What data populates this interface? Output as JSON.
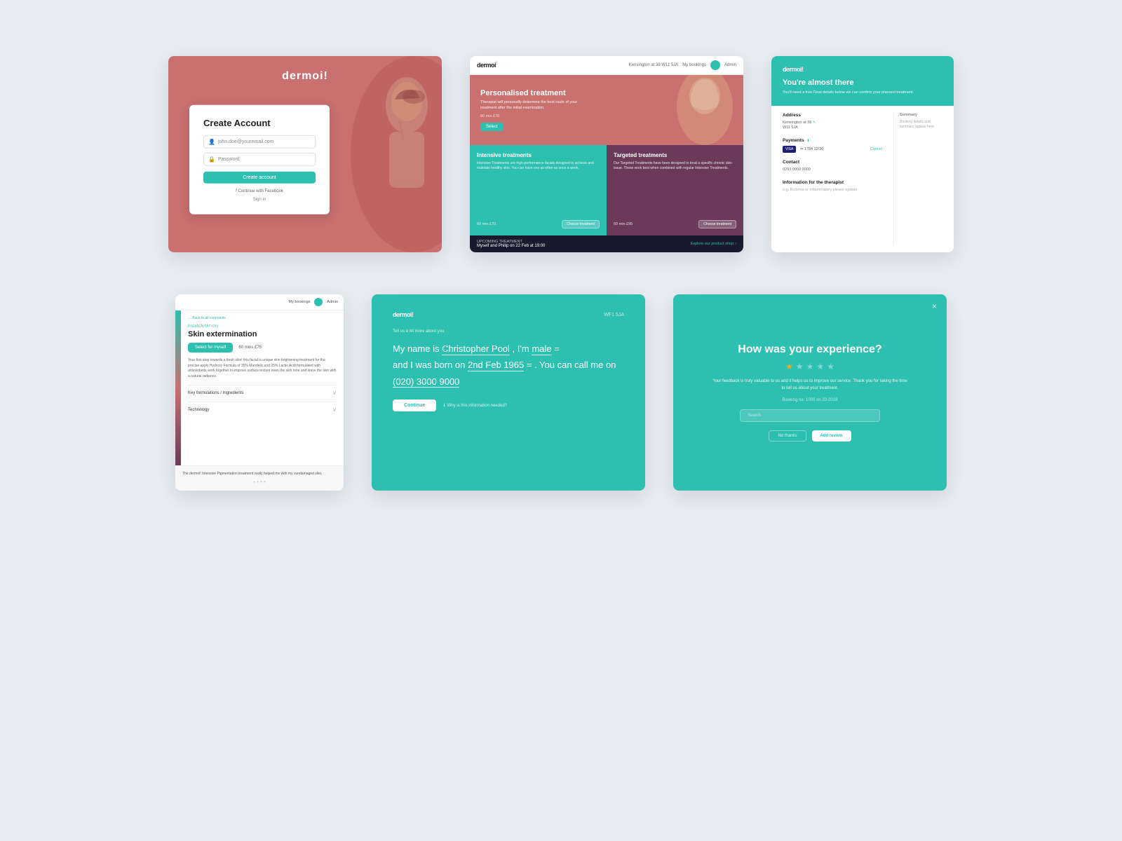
{
  "page": {
    "bg_color": "#e8edf2"
  },
  "card1": {
    "logo": "dermoi!",
    "title": "Create Account",
    "email_placeholder": "john.doe@youremail.com",
    "password_placeholder": "Password",
    "create_btn": "Create account",
    "fb_label": "Continue with Facebook",
    "signin_label": "Sign in"
  },
  "card2": {
    "logo": "dermoi!",
    "location": "Kensington at 38 W11 5JA",
    "my_bookings": "My bookings",
    "hero": {
      "title": "Personalised treatment",
      "description": "Therapist will personally determine the best route of your treatment after the initial examination.",
      "price": "60 min £70",
      "btn": "Select"
    },
    "intensive": {
      "title": "Intensive treatments",
      "description": "Intensive Treatments are high-performance facials designed to achieve and maintain healthy skin. You can have one as often as once a week.",
      "price": "60 min £70",
      "btn": "Choose treatment"
    },
    "targeted": {
      "title": "Targeted treatments",
      "description": "Our Targeted Treatments have been designed to treat a specific chronic skin issue. These work best when combined with regular Intensive Treatments.",
      "price": "60 min £95",
      "btn": "Choose treatment"
    },
    "footer": {
      "label": "UPCOMING TREATMENT",
      "booking": "Myself and Philip on 22 Feb at 19:00",
      "explore": "Explore our product shop"
    }
  },
  "card3": {
    "logo": "dermoi!",
    "header_title": "You're almost there",
    "header_desc": "You'll need a free Final details below we can confirm your planned treatment.",
    "address_label": "Address",
    "address_value": "Kensington at 38",
    "address_post": "W11 5JA",
    "payments_label": "Payments",
    "card_number": "•• 1784    12/30",
    "cancel": "Cancel",
    "contact_label": "Contact",
    "phone": "0203 0000 9000",
    "therapist_label": "Information for the therapist",
    "therapist_placeholder": "e.g. Eczema or inflammatory please update"
  },
  "card4": {
    "my_bookings": "My bookings",
    "back_link": "Back to all comments",
    "category": "PIGMENTATION",
    "title": "Skin extermination",
    "btn_select": "Select for myself",
    "price": "60 mins £75",
    "description": "Your first step towards a fresh skin! this facial is unique skin brightening treatment for the precise apply Hydroxy Formula of 35% Mandelic and 25% Lactic Acid formulated with antioxidants work together to improve surface texture even the skin tone and leave the skin with a natural radiance.",
    "ingredients_label": "Key formulations / Ingredients",
    "technology_label": "Technology",
    "testimonial": "The dermoi! Intensive Pigmentation treatment really helped me with my sundamaged skin."
  },
  "card5": {
    "logo": "dermoi!",
    "wifi": "WF1 5JA",
    "tell_us": "Tell us a bit more about you.",
    "sentence_prefix": "My name is",
    "name": "Christopher Pool",
    "sentence_mid1": ", I'm",
    "gender": "male",
    "sentence_mid2": "=",
    "sentence_mid3": "and I was born on",
    "dob": "2nd Feb 1965",
    "sentence_mid4": "= . You can call me on",
    "phone": "(020) 3000 9000",
    "continue_btn": "Continue",
    "why_link": "Why is this information needed?"
  },
  "card6": {
    "close": "×",
    "title": "How was your experience?",
    "stars": [
      true,
      false,
      false,
      false,
      false
    ],
    "review_text": "Your feedback is truly valuable to us and it helps us to improve our service. Thank you for taking the time to tell us about your treatment.",
    "booking_ref": "Booking no: 1000 on 20-2018",
    "search_placeholder": "Search",
    "btn_no": "No thanks",
    "btn_add": "Add review"
  }
}
